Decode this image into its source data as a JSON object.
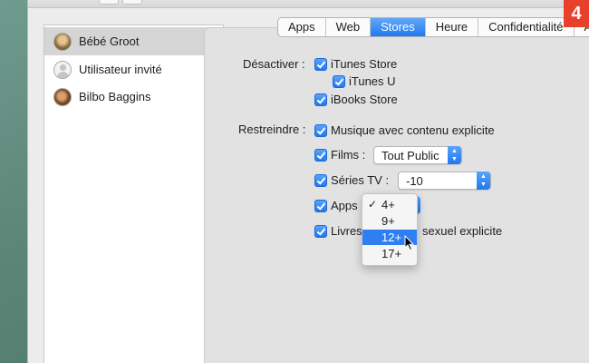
{
  "step_badge": "4",
  "users": [
    {
      "name": "Bébé Groot",
      "selected": true
    },
    {
      "name": "Utilisateur invité",
      "selected": false
    },
    {
      "name": "Bilbo Baggins",
      "selected": false
    }
  ],
  "tabs": [
    {
      "label": "Apps",
      "active": false
    },
    {
      "label": "Web",
      "active": false
    },
    {
      "label": "Stores",
      "active": true
    },
    {
      "label": "Heure",
      "active": false
    },
    {
      "label": "Confidentialité",
      "active": false
    },
    {
      "label": "A",
      "active": false
    }
  ],
  "disable": {
    "label": "Désactiver :",
    "items": [
      {
        "label": "iTunes Store",
        "checked": true
      },
      {
        "label": "iTunes U",
        "checked": true
      },
      {
        "label": "iBooks Store",
        "checked": true
      }
    ]
  },
  "restrict": {
    "label": "Restreindre :",
    "music": {
      "label": "Musique avec contenu explicite",
      "checked": true
    },
    "films": {
      "label": "Films :",
      "checked": true,
      "value": "Tout Public"
    },
    "tv": {
      "label": "Séries TV :",
      "checked": true,
      "value": "-10"
    },
    "apps": {
      "label": "Apps",
      "checked": true,
      "value": "4+"
    },
    "books": {
      "label_left": "Livres",
      "label_right": "sexuel explicite",
      "checked": true
    }
  },
  "apps_menu": {
    "options": [
      "4+",
      "9+",
      "12+",
      "17+"
    ],
    "checked": "4+",
    "highlighted": "12+"
  },
  "colors": {
    "accent": "#1f78ee",
    "highlight": "#2f7ff3",
    "badge": "#e8412b"
  }
}
